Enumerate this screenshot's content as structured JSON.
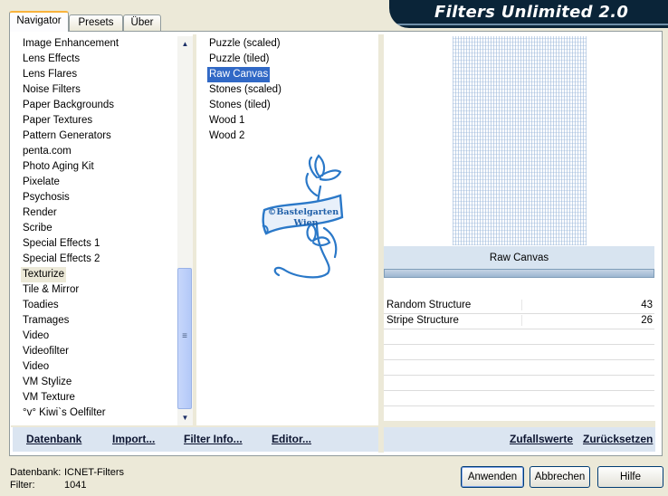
{
  "tabs": [
    {
      "label": "Navigator",
      "active": true
    },
    {
      "label": "Presets",
      "active": false
    },
    {
      "label": "Über",
      "active": false
    }
  ],
  "banner": {
    "title": "Filters Unlimited 2.0"
  },
  "categories": [
    {
      "label": "Image Enhancement",
      "selected": false
    },
    {
      "label": "Lens Effects",
      "selected": false
    },
    {
      "label": "Lens Flares",
      "selected": false
    },
    {
      "label": "Noise Filters",
      "selected": false
    },
    {
      "label": "Paper Backgrounds",
      "selected": false
    },
    {
      "label": "Paper Textures",
      "selected": false
    },
    {
      "label": "Pattern Generators",
      "selected": false
    },
    {
      "label": "penta.com",
      "selected": false
    },
    {
      "label": "Photo Aging Kit",
      "selected": false
    },
    {
      "label": "Pixelate",
      "selected": false
    },
    {
      "label": "Psychosis",
      "selected": false
    },
    {
      "label": "Render",
      "selected": false
    },
    {
      "label": "Scribe",
      "selected": false
    },
    {
      "label": "Special Effects 1",
      "selected": false
    },
    {
      "label": "Special Effects 2",
      "selected": false
    },
    {
      "label": "Texturize",
      "selected": true
    },
    {
      "label": "Tile & Mirror",
      "selected": false
    },
    {
      "label": "Toadies",
      "selected": false
    },
    {
      "label": "Tramages",
      "selected": false
    },
    {
      "label": "Video",
      "selected": false
    },
    {
      "label": "Videofilter",
      "selected": false
    },
    {
      "label": "Video",
      "selected": false
    },
    {
      "label": "VM Stylize",
      "selected": false
    },
    {
      "label": "VM Texture",
      "selected": false
    },
    {
      "label": "°v° Kiwi`s Oelfilter",
      "selected": false
    }
  ],
  "filters": [
    {
      "label": "Puzzle (scaled)",
      "selected": false
    },
    {
      "label": "Puzzle (tiled)",
      "selected": false
    },
    {
      "label": "Raw Canvas",
      "selected": true
    },
    {
      "label": "Stones (scaled)",
      "selected": false
    },
    {
      "label": "Stones (tiled)",
      "selected": false
    },
    {
      "label": "Wood 1",
      "selected": false
    },
    {
      "label": "Wood 2",
      "selected": false
    }
  ],
  "logo": {
    "line1": "©Bastelgarten",
    "line2": "Wien"
  },
  "preview": {
    "filter_name": "Raw Canvas"
  },
  "params": [
    {
      "label": "Random Structure",
      "value": "43"
    },
    {
      "label": "Stripe Structure",
      "value": "26"
    }
  ],
  "bottom_links": {
    "datenbank": "Datenbank",
    "import": "Import...",
    "filter_info": "Filter Info...",
    "editor": "Editor...",
    "zufallswerte": "Zufallswerte",
    "zuruecksetzen": "Zurücksetzen"
  },
  "status": {
    "db_label": "Datenbank:",
    "db_value": "ICNET-Filters",
    "filter_label": "Filter:",
    "filter_value": "1041"
  },
  "buttons": {
    "apply": "Anwenden",
    "cancel": "Abbrechen",
    "help": "Hilfe"
  },
  "colors": {
    "selection": "#3169c6",
    "banner_bg": "#0a2438",
    "logo": "#2a78c8"
  }
}
